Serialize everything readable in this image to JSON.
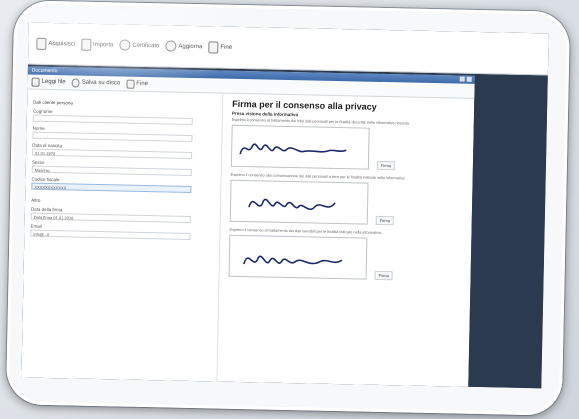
{
  "toolbar": {
    "items": [
      {
        "label": "Acquisisci",
        "icon": "scanner-icon"
      },
      {
        "label": "Importa",
        "icon": "import-icon"
      },
      {
        "label": "Certificato",
        "icon": "certificate-icon"
      },
      {
        "label": "Aggiorna",
        "icon": "refresh-icon"
      },
      {
        "label": "Fine",
        "icon": "finish-icon"
      }
    ]
  },
  "window": {
    "title": "Documento",
    "toolbar": [
      {
        "label": "Leggi file",
        "icon": "read-file-icon"
      },
      {
        "label": "Salva su disco",
        "icon": "save-icon"
      },
      {
        "label": "Fine",
        "icon": "finish-icon"
      }
    ]
  },
  "form": {
    "section_personal": "Dati cliente persona",
    "fields": [
      {
        "label": "Cognome",
        "value": ""
      },
      {
        "label": "Nome",
        "value": ""
      },
      {
        "label": "Data di nascita",
        "value": "01.01.1970"
      },
      {
        "label": "Sesso",
        "value": "Maschio"
      },
      {
        "label": "Codice fiscale",
        "value": "XXXXXXXXXXXX",
        "highlight": true
      }
    ],
    "section_other": "Altro",
    "fields2": [
      {
        "label": "Data della firma",
        "value": "Data firma 01.01.2016"
      },
      {
        "label": "Email",
        "value": "info@...it"
      }
    ]
  },
  "privacy": {
    "title": "Firma per il consenso alla privacy",
    "subtitle": "Presa visione della informativa",
    "blocks": [
      {
        "text": "Esprimo il consenso al trattamento dei miei dati personali per le finalità descritte nella informativa ricevuta.",
        "button": "Firma"
      },
      {
        "text": "Esprimo il consenso alla comunicazione dei dati personali a terzi per le finalità indicate nella informativa.",
        "button": "Firma"
      },
      {
        "text": "Esprimo il consenso al trattamento dei dati sensibili per le finalità indicate nella informativa.",
        "button": "Firma"
      }
    ]
  }
}
